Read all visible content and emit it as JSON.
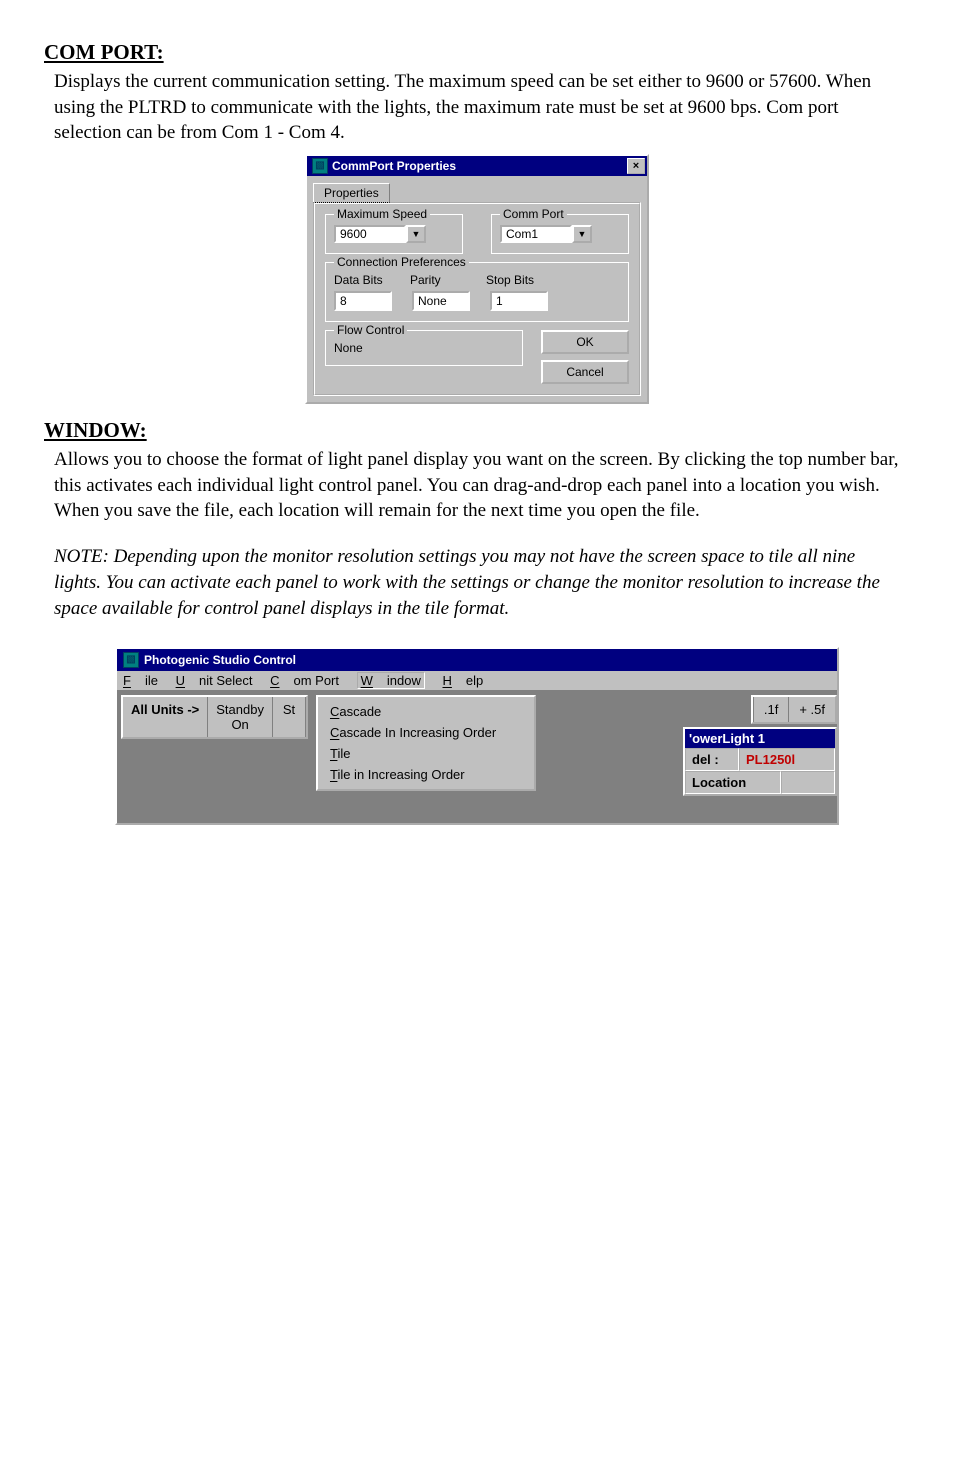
{
  "sections": {
    "comport": {
      "heading": "COM PORT:",
      "body": "Displays the current communication setting.  The maximum speed can be set either to 9600 or 57600.  When using the PLTRD to communicate with the lights, the maximum rate must be set at 9600 bps.  Com port selection can be from Com 1 - Com 4."
    },
    "window": {
      "heading": "WINDOW:",
      "body": " Allows you to choose the format of light panel display you want on the screen.  By clicking the top number bar, this activates each individual light control panel.  You can drag-and-drop each panel into a location you wish.  When you save the file, each location will remain for the next time you open the file.",
      "note": "NOTE:  Depending upon the monitor resolution settings you may not have the screen space to tile all nine lights.  You can activate each panel to work with the settings or change the monitor resolution to increase the space available for control panel displays in the tile format."
    }
  },
  "comm_dialog": {
    "title": "CommPort Properties",
    "close": "×",
    "tab": "Properties",
    "groups": {
      "maxspeed": {
        "title": "Maximum Speed",
        "value": "9600"
      },
      "commport": {
        "title": "Comm Port",
        "value": "Com1"
      },
      "connpref": {
        "title": "Connection Preferences",
        "labels": {
          "databits": "Data Bits",
          "parity": "Parity",
          "stopbits": "Stop Bits"
        },
        "values": {
          "databits": "8",
          "parity": "None",
          "stopbits": "1"
        }
      },
      "flow": {
        "title": "Flow Control",
        "value": "None"
      }
    },
    "buttons": {
      "ok": "OK",
      "cancel": "Cancel"
    }
  },
  "psc_window": {
    "title": "Photogenic Studio Control",
    "menus": {
      "file": "File",
      "unit_select": "Unit Select",
      "com_port": "Com Port",
      "window": "Window",
      "help": "Help"
    },
    "toolbar": {
      "all_units": "All Units ->",
      "standby_on": {
        "line1": "Standby",
        "line2": "On"
      },
      "st": "St"
    },
    "drop_menu": {
      "cascade": "Cascade",
      "cascade_inc": "Cascade In Increasing Order",
      "tile": "Tile",
      "tile_inc": "Tile in Increasing Order"
    },
    "top_right": {
      "a": ".1f",
      "b": "+ .5f"
    },
    "subwindow": {
      "title": "'owerLight 1",
      "row1": {
        "label": "del :",
        "value": "PL1250l"
      },
      "row2": {
        "label": "Location",
        "value": ""
      }
    }
  }
}
